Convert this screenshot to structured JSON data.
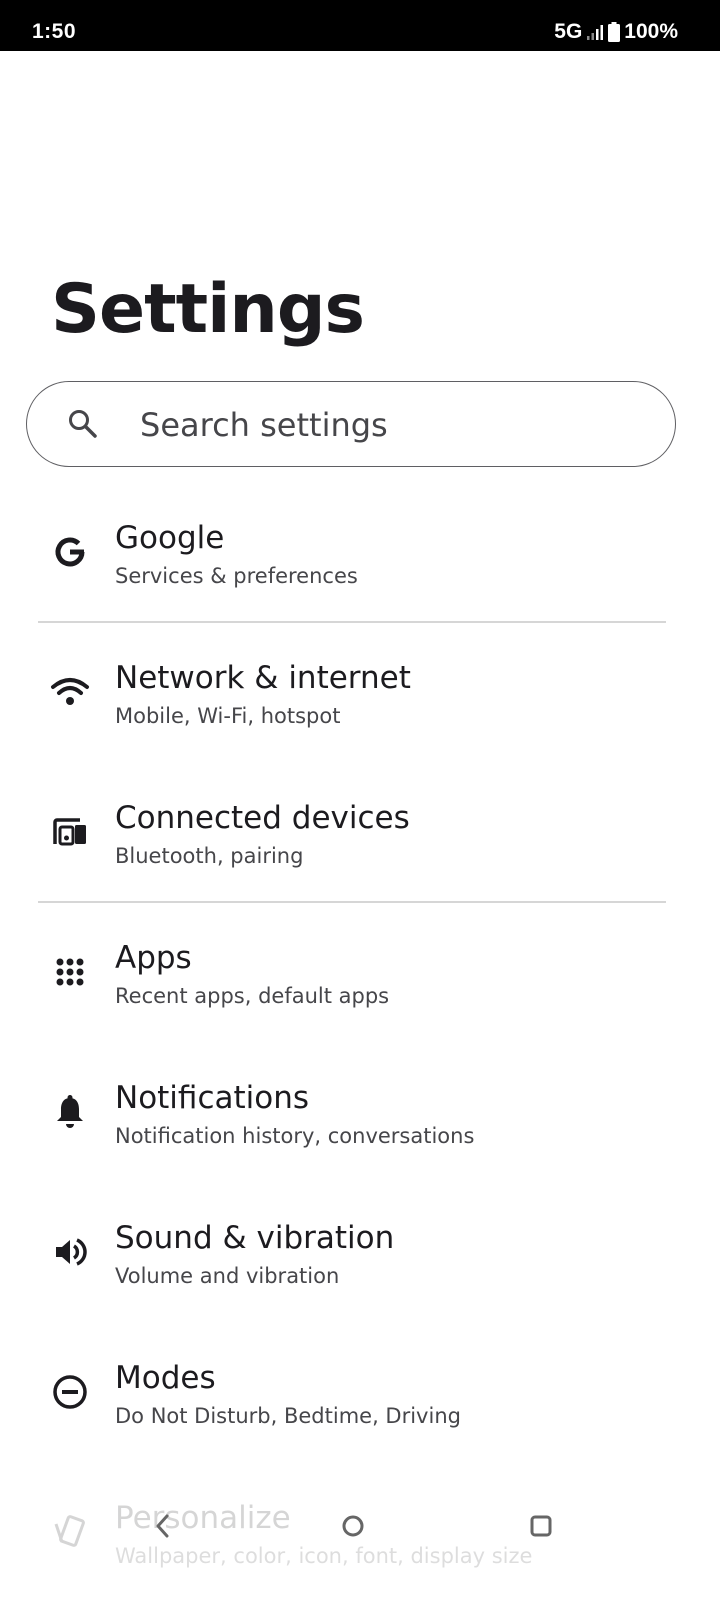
{
  "status_bar": {
    "time": "1:50",
    "network": "5G",
    "battery": "100%"
  },
  "page_title": "Settings",
  "search": {
    "placeholder": "Search settings"
  },
  "items": [
    {
      "title": "Google",
      "subtitle": "Services & preferences",
      "icon": "google-g-icon"
    },
    {
      "title": "Network & internet",
      "subtitle": "Mobile, Wi-Fi, hotspot",
      "icon": "wifi-icon"
    },
    {
      "title": "Connected devices",
      "subtitle": "Bluetooth, pairing",
      "icon": "devices-icon"
    },
    {
      "title": "Apps",
      "subtitle": "Recent apps, default apps",
      "icon": "apps-grid-icon"
    },
    {
      "title": "Notifications",
      "subtitle": "Notification history, conversations",
      "icon": "bell-icon"
    },
    {
      "title": "Sound & vibration",
      "subtitle": "Volume and vibration",
      "icon": "speaker-icon"
    },
    {
      "title": "Modes",
      "subtitle": "Do Not Disturb, Bedtime, Driving",
      "icon": "minus-circle-icon"
    },
    {
      "title": "Personalize",
      "subtitle": "Wallpaper, color, icon, font, display size",
      "icon": "palette-icon"
    }
  ],
  "colors": {
    "text_primary": "#1c1b1f",
    "text_secondary": "#46464a",
    "divider": "#d6d6d6",
    "status_bar_bg": "#000000"
  }
}
